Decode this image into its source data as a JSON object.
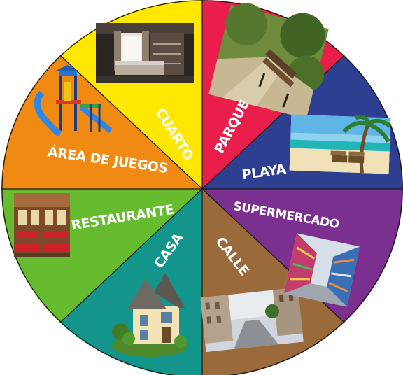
{
  "wheel": {
    "segments": [
      {
        "label": "PARQUE",
        "color": "#E91E4A",
        "photo": "park-bench-photo"
      },
      {
        "label": "PLAYA",
        "color": "#2E3F91",
        "photo": "beach-palm-photo"
      },
      {
        "label": "SUPERMERCADO",
        "color": "#7B2F8F",
        "photo": "supermarket-aisle-photo"
      },
      {
        "label": "CALLE",
        "color": "#9A6A3A",
        "photo": "city-street-photo"
      },
      {
        "label": "CASA",
        "color": "#13958C",
        "photo": "house-photo"
      },
      {
        "label": "RESTAURANTE",
        "color": "#66BB2E",
        "photo": "restaurant-photo"
      },
      {
        "label": "ÁREA DE JUEGOS",
        "color": "#F18A12",
        "photo": "playground-photo"
      },
      {
        "label": "CUARTO",
        "color": "#FFE800",
        "photo": "bedroom-photo"
      }
    ],
    "divider_color": "#1a1a1a"
  }
}
